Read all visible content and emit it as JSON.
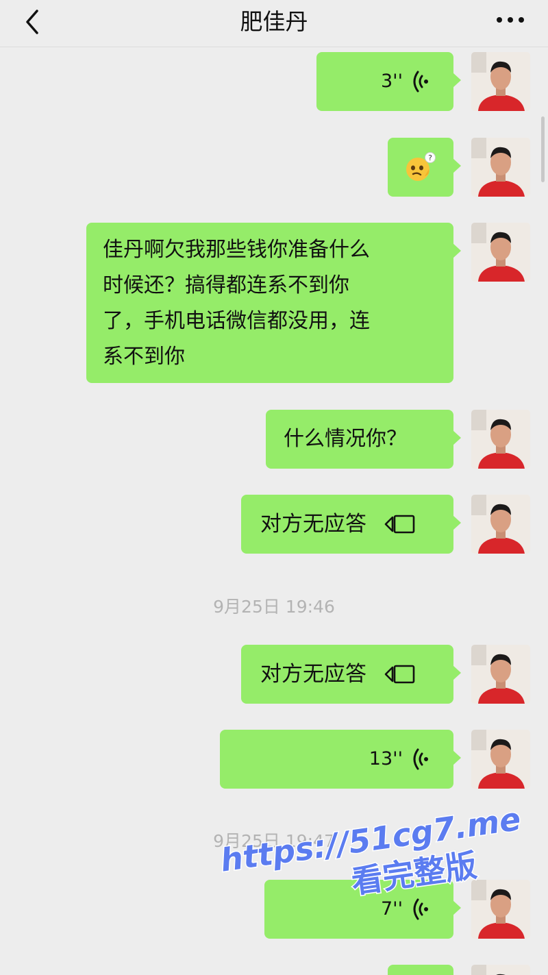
{
  "header": {
    "title": "肥佳丹",
    "back_icon": "chevron-left-icon",
    "more_icon": "more-horizontal-icon"
  },
  "messages": [
    {
      "type": "voice",
      "duration": "3''"
    },
    {
      "type": "sticker",
      "icon": "confused-emoji-icon"
    },
    {
      "type": "text",
      "lines": [
        "佳丹啊欠我那些钱你准备什么",
        "时候还？搞得都连系不到你",
        "了，手机电话微信都没用，连",
        "系不到你"
      ]
    },
    {
      "type": "text",
      "text": "什么情况你？"
    },
    {
      "type": "video-call",
      "text": "对方无应答"
    },
    {
      "type": "timestamp",
      "text": "9月25日 19:46"
    },
    {
      "type": "video-call",
      "text": "对方无应答"
    },
    {
      "type": "voice",
      "duration": "13''"
    },
    {
      "type": "timestamp",
      "text": "9月25日 19:47"
    },
    {
      "type": "voice",
      "duration": "7''"
    }
  ],
  "watermark": {
    "line1": "https://51cg7.me",
    "line2": "看完整版",
    "color": "#5b7cf0"
  },
  "colors": {
    "bubble": "#95ec69",
    "background": "#ededed",
    "timestamp": "#b3b3b3"
  }
}
